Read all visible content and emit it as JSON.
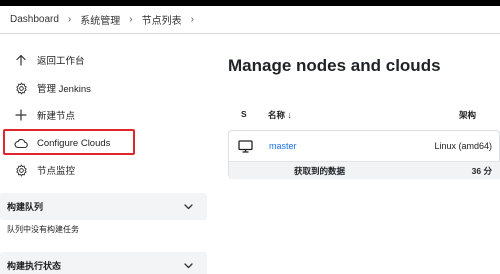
{
  "breadcrumb": [
    "Dashboard",
    "系统管理",
    "节点列表"
  ],
  "sidebar": {
    "tasks": [
      {
        "label": "返回工作台",
        "icon": "arrow-up-icon"
      },
      {
        "label": "管理 Jenkins",
        "icon": "gear-icon"
      },
      {
        "label": "新建节点",
        "icon": "plus-icon"
      },
      {
        "label": "Configure Clouds",
        "icon": "cloud-icon"
      },
      {
        "label": "节点监控",
        "icon": "gear-icon"
      }
    ],
    "build_queue": {
      "title": "构建队列",
      "empty_text": "队列中没有构建任务"
    },
    "executor_status": {
      "title": "构建执行状态"
    }
  },
  "main": {
    "title": "Manage nodes and clouds",
    "table": {
      "headers": {
        "s": "S",
        "name": "名称 ↓",
        "arch": "架构"
      },
      "rows": [
        {
          "name": "master",
          "arch": "Linux (amd64)",
          "icon": "monitor-icon"
        }
      ],
      "footer": {
        "label": "获取到的数据",
        "value": "36 分"
      }
    }
  },
  "colors": {
    "highlight": "#e0262b",
    "link": "#1a73e8",
    "top_bar": "#000000"
  }
}
